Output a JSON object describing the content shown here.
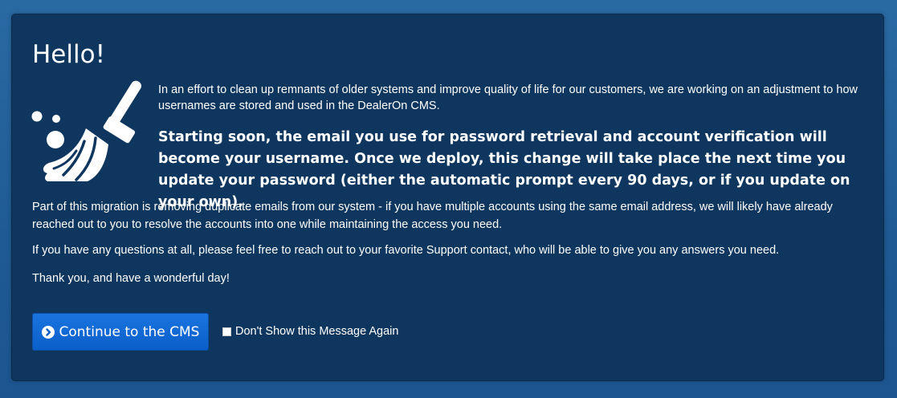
{
  "dialog": {
    "title": "Hello!",
    "icon": "broom-icon",
    "intro": "In an effort to clean up remnants of older systems and improve quality of life for our customers, we are working on an adjustment to how usernames are stored and used in the DealerOn CMS.",
    "headline": "Starting soon, the email you use for password retrieval and account verification will become your username. Once we deploy, this change will take place the next time you update your password (either the automatic prompt every 90 days, or if you update on your own).",
    "paragraphs": [
      "Part of this migration is removing duplicate emails from our system - if you have multiple accounts using the same email address, we will likely have already reached out to you to resolve the accounts into one while maintaining the access you need.",
      "If you have any questions at all, please feel free to reach out to your favorite Support contact, who will be able to give you any answers you need.",
      "Thank you, and have a wonderful day!"
    ],
    "continue_button": {
      "label": "Continue to the CMS",
      "icon": "chevron-circle-right-icon"
    },
    "dont_show": {
      "label": "Don't Show this Message Again",
      "checked": false
    }
  },
  "colors": {
    "background": "#1f5a94",
    "panel": "#0e365e",
    "button": "#0b5fc8",
    "text": "#ffffff"
  }
}
